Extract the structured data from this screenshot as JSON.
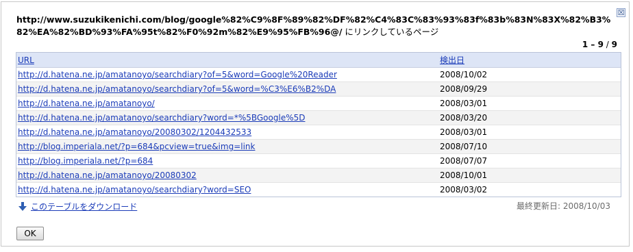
{
  "dialog": {
    "title_url": "http://www.suzukikenichi.com/blog/google%82%C9%8F%89%82%DF%82%C4%83C%83%93%83f%83b%83N%83X%82%B3%82%EA%82%BD%93%FA%95t%82%F0%92m%82%E9%95%FB%96@/",
    "title_suffix": " にリンクしているページ",
    "close_label": "☒",
    "count_range": "1 – 9",
    "count_sep": " / ",
    "count_total": "9",
    "columns": {
      "url": "URL",
      "date": "検出日"
    },
    "rows": [
      {
        "url": "http://d.hatena.ne.jp/amatanoyo/searchdiary?of=5&word=Google%20Reader",
        "date": "2008/10/02"
      },
      {
        "url": "http://d.hatena.ne.jp/amatanoyo/searchdiary?of=5&word=%C3%E6%B2%DA",
        "date": "2008/09/29"
      },
      {
        "url": "http://d.hatena.ne.jp/amatanoyo/",
        "date": "2008/03/01"
      },
      {
        "url": "http://d.hatena.ne.jp/amatanoyo/searchdiary?word=*%5BGoogle%5D",
        "date": "2008/03/20"
      },
      {
        "url": "http://d.hatena.ne.jp/amatanoyo/20080302/1204432533",
        "date": "2008/03/01"
      },
      {
        "url": "http://blog.imperiala.net/?p=684&pcview=true&img=link",
        "date": "2008/07/10"
      },
      {
        "url": "http://blog.imperiala.net/?p=684",
        "date": "2008/07/07"
      },
      {
        "url": "http://d.hatena.ne.jp/amatanoyo/20080302",
        "date": "2008/10/01"
      },
      {
        "url": "http://d.hatena.ne.jp/amatanoyo/searchdiary?word=SEO",
        "date": "2008/03/02"
      }
    ],
    "download_label": "このテーブルをダウンロード",
    "last_updated": "最終更新日: 2008/10/03",
    "ok_label": "OK"
  },
  "colors": {
    "link": "#1a3bb8",
    "header_bg": "#dde5f6",
    "alt_row": "#f3f3f3"
  },
  "icons": {
    "close": "close-icon",
    "download": "download-arrow-icon"
  }
}
